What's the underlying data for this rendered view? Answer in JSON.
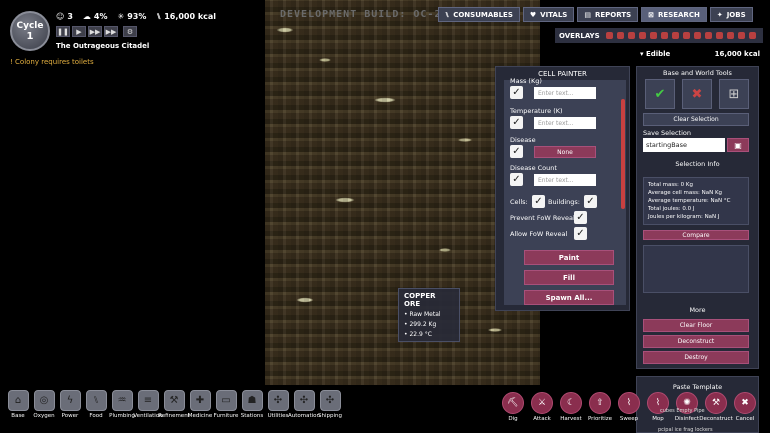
{
  "hud": {
    "cycle_label": "Cycle",
    "cycle_number": "1",
    "duplicants": "3",
    "stress": "4%",
    "health": "93%",
    "calories": "16,000 kcal",
    "colony_name": "The Outrageous Citadel",
    "alert": "Colony requires toilets"
  },
  "dev_build": "DEVELOPMENT BUILD: OC-254781",
  "topnav": {
    "consumables": "CONSUMABLES",
    "vitals": "VITALS",
    "reports": "REPORTS",
    "research": "RESEARCH",
    "jobs": "JOBS"
  },
  "overlays_label": "OVERLAYS",
  "edible": {
    "label": "Edible",
    "value": "16,000 kcal"
  },
  "cell_painter": {
    "title": "CELL PAINTER",
    "mass_label": "Mass (Kg)",
    "temperature_label": "Temperature (K)",
    "disease_label": "Disease",
    "disease_value": "None",
    "disease_count_label": "Disease Count",
    "placeholder": "Enter text...",
    "cells_label": "Cells:",
    "buildings_label": "Buildings:",
    "prevent_fow": "Prevent FoW Reveal",
    "allow_fow": "Allow FoW Reveal",
    "paint": "Paint",
    "fill": "Fill",
    "spawn_all": "Spawn All..."
  },
  "right_panel": {
    "title": "Base and World Tools",
    "clear_selection": "Clear Selection",
    "save_selection_label": "Save Selection",
    "save_name": "startingBase",
    "selection_info_title": "Selection Info",
    "info_lines": [
      "Total mass: 0 Kg",
      "Average cell mass: NaN Kg",
      "Average temperature: NaN °C",
      "Total joules: 0.0 J",
      "Joules per kilogram: NaN J"
    ],
    "compare": "Compare",
    "more_title": "More",
    "clear_floor": "Clear Floor",
    "deconstruct": "Deconstruct",
    "destroy": "Destroy",
    "paste_template": "Paste Template"
  },
  "tooltip": {
    "title": "COPPER ORE",
    "line1": "Raw Metal",
    "line2": "299.2 Kg",
    "line3": "22.9 °C"
  },
  "build_menu": [
    "Base",
    "Oxygen",
    "Power",
    "Food",
    "Plumbing",
    "Ventilation",
    "Refinement",
    "Medicine",
    "Furniture",
    "Stations",
    "Utilities",
    "Automation",
    "Shipping"
  ],
  "tools_menu": [
    "Dig",
    "Attack",
    "Harvest",
    "Prioritize",
    "Sweep",
    "Mop",
    "Disinfect",
    "Deconstruct",
    "Cancel"
  ],
  "tool_sublabels": {
    "row1": "cubes  Empty Pipe",
    "row2": "pcipal  ice  frag  lockers"
  }
}
